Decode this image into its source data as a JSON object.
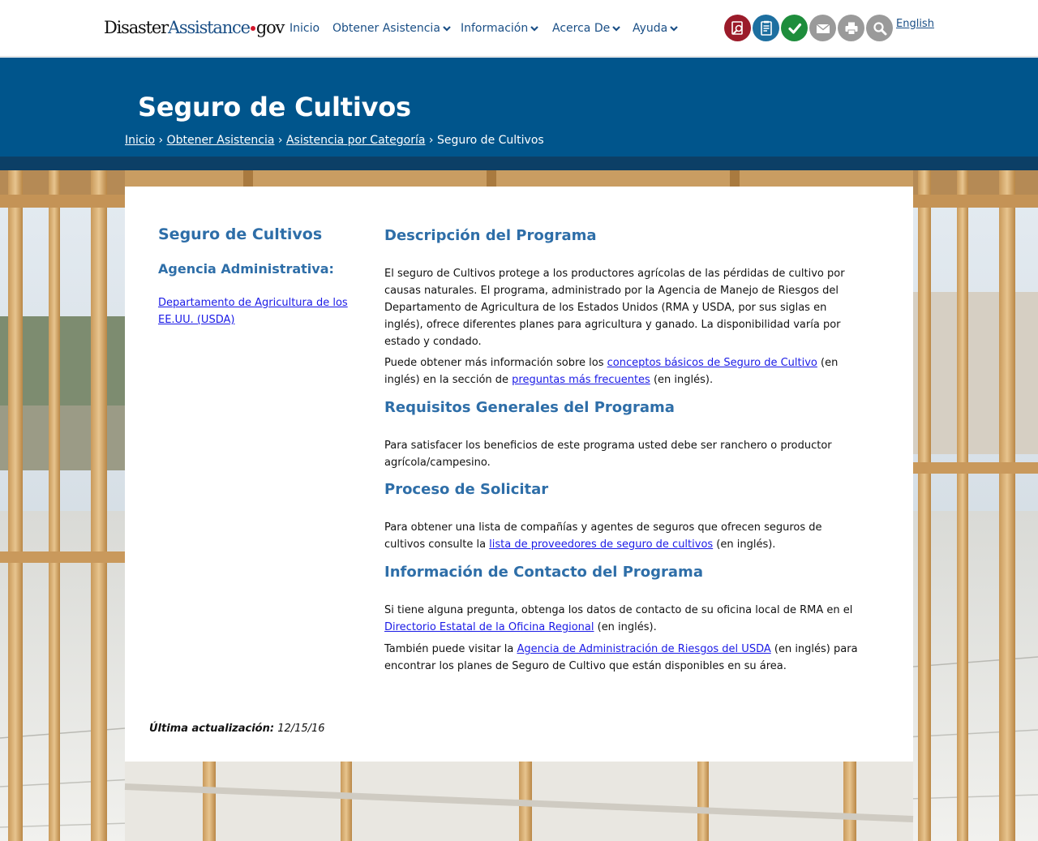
{
  "header": {
    "logo": {
      "part1": "Disaster",
      "part2": "Assistance",
      "part3": "gov"
    },
    "nav": [
      {
        "label": "Inicio",
        "has_menu": false
      },
      {
        "label": "Obtener Asistencia",
        "has_menu": true
      },
      {
        "label": "Información",
        "has_menu": true
      },
      {
        "label": "Acerca De",
        "has_menu": true
      },
      {
        "label": "Ayuda",
        "has_menu": true
      }
    ],
    "tools": [
      {
        "icon": "search-document-icon",
        "color": "#9b1b2a"
      },
      {
        "icon": "checklist-icon",
        "color": "#1d6fa0"
      },
      {
        "icon": "checkmark-icon",
        "color": "#1e8d3c"
      },
      {
        "icon": "envelope-icon",
        "color": "#9a9a9a"
      },
      {
        "icon": "printer-icon",
        "color": "#9a9a9a"
      },
      {
        "icon": "magnifier-icon",
        "color": "#9a9a9a"
      }
    ],
    "language_link": "English"
  },
  "banner": {
    "title": "Seguro de Cultivos",
    "breadcrumb": {
      "items": [
        "Inicio",
        "Obtener Asistencia",
        "Asistencia por Categoría"
      ],
      "current": "Seguro de Cultivos",
      "separator": "›"
    }
  },
  "sidebar": {
    "title": "Seguro de Cultivos",
    "agency_label": "Agencia Administrativa:",
    "agency_link": "Departamento de Agricultura de los EE.UU. (USDA)"
  },
  "content": {
    "description": {
      "heading": "Descripción del Programa",
      "para1": "El seguro de Cultivos protege a los productores agrícolas de las pérdidas de cultivo por causas naturales. El programa, administrado por la Agencia de Manejo de Riesgos del Departamento de Agricultura de los Estados Unidos (RMA  y USDA, por sus siglas en inglés), ofrece diferentes planes para agricultura y ganado. La disponibilidad varía por estado y condado.",
      "para2_a": "Puede obtener más información sobre los ",
      "para2_link1": "conceptos básicos de Seguro de Cultivo",
      "para2_b": " (en inglés) en la sección de ",
      "para2_link2": "preguntas más frecuentes",
      "para2_c": " (en inglés)."
    },
    "requirements": {
      "heading": "Requisitos Generales del Programa",
      "para": "Para satisfacer los beneficios de este programa usted debe ser ranchero o productor agrícola/campesino."
    },
    "process": {
      "heading": "Proceso de Solicitar",
      "para_a": "Para obtener una lista de compañías y agentes de seguros que ofrecen seguros de cultivos consulte la ",
      "para_link": "lista de proveedores de seguro de cultivos",
      "para_b": " (en inglés)."
    },
    "contact": {
      "heading": "Información de Contacto del Programa",
      "para1_a": "Si tiene alguna pregunta, obtenga los datos de contacto de su oficina local de RMA en el ",
      "para1_link": "Directorio Estatal de la Oficina Regional",
      "para1_b": " (en inglés).",
      "para2_a": "También puede visitar la ",
      "para2_link": "Agencia de Administración de Riesgos del USDA",
      "para2_b": " (en inglés) para encontrar los planes de Seguro de Cultivo que están disponibles en su área."
    }
  },
  "footer": {
    "updated_label": "Última actualización:",
    "updated_date": "12/15/16"
  }
}
